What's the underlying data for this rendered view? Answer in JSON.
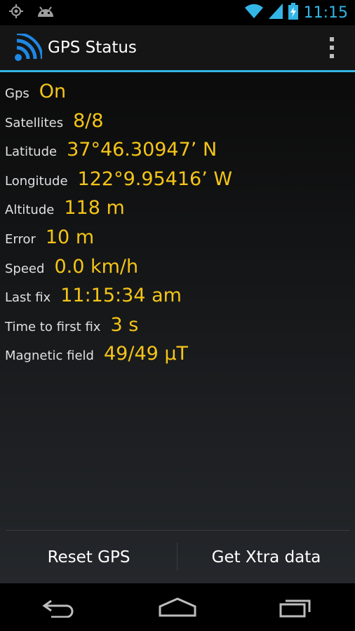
{
  "status_bar": {
    "time": "11:15",
    "icons": [
      "gps-icon",
      "android-icon",
      "wifi-icon",
      "signal-icon",
      "battery-charging-icon"
    ]
  },
  "action_bar": {
    "title": "GPS Status",
    "icon": "gps-signal-icon",
    "overflow_icon": "overflow-menu-icon"
  },
  "rows": [
    {
      "label": "Gps",
      "value": "On"
    },
    {
      "label": "Satellites",
      "value": "8/8"
    },
    {
      "label": "Latitude",
      "value": "37°46.30947’ N"
    },
    {
      "label": "Longitude",
      "value": "122°9.95416’ W"
    },
    {
      "label": "Altitude",
      "value": "118 m"
    },
    {
      "label": "Error",
      "value": "10 m"
    },
    {
      "label": "Speed",
      "value": "0.0 km/h"
    },
    {
      "label": "Last fix",
      "value": "11:15:34 am"
    },
    {
      "label": "Time to first fix",
      "value": "3 s"
    },
    {
      "label": "Magnetic field",
      "value": "49/49 µT"
    }
  ],
  "buttons": {
    "reset": "Reset GPS",
    "xtra": "Get Xtra data"
  },
  "nav_bar": [
    "back-icon",
    "home-icon",
    "recent-apps-icon"
  ],
  "colors": {
    "accent": "#33b5e5",
    "value": "#f5c518"
  }
}
